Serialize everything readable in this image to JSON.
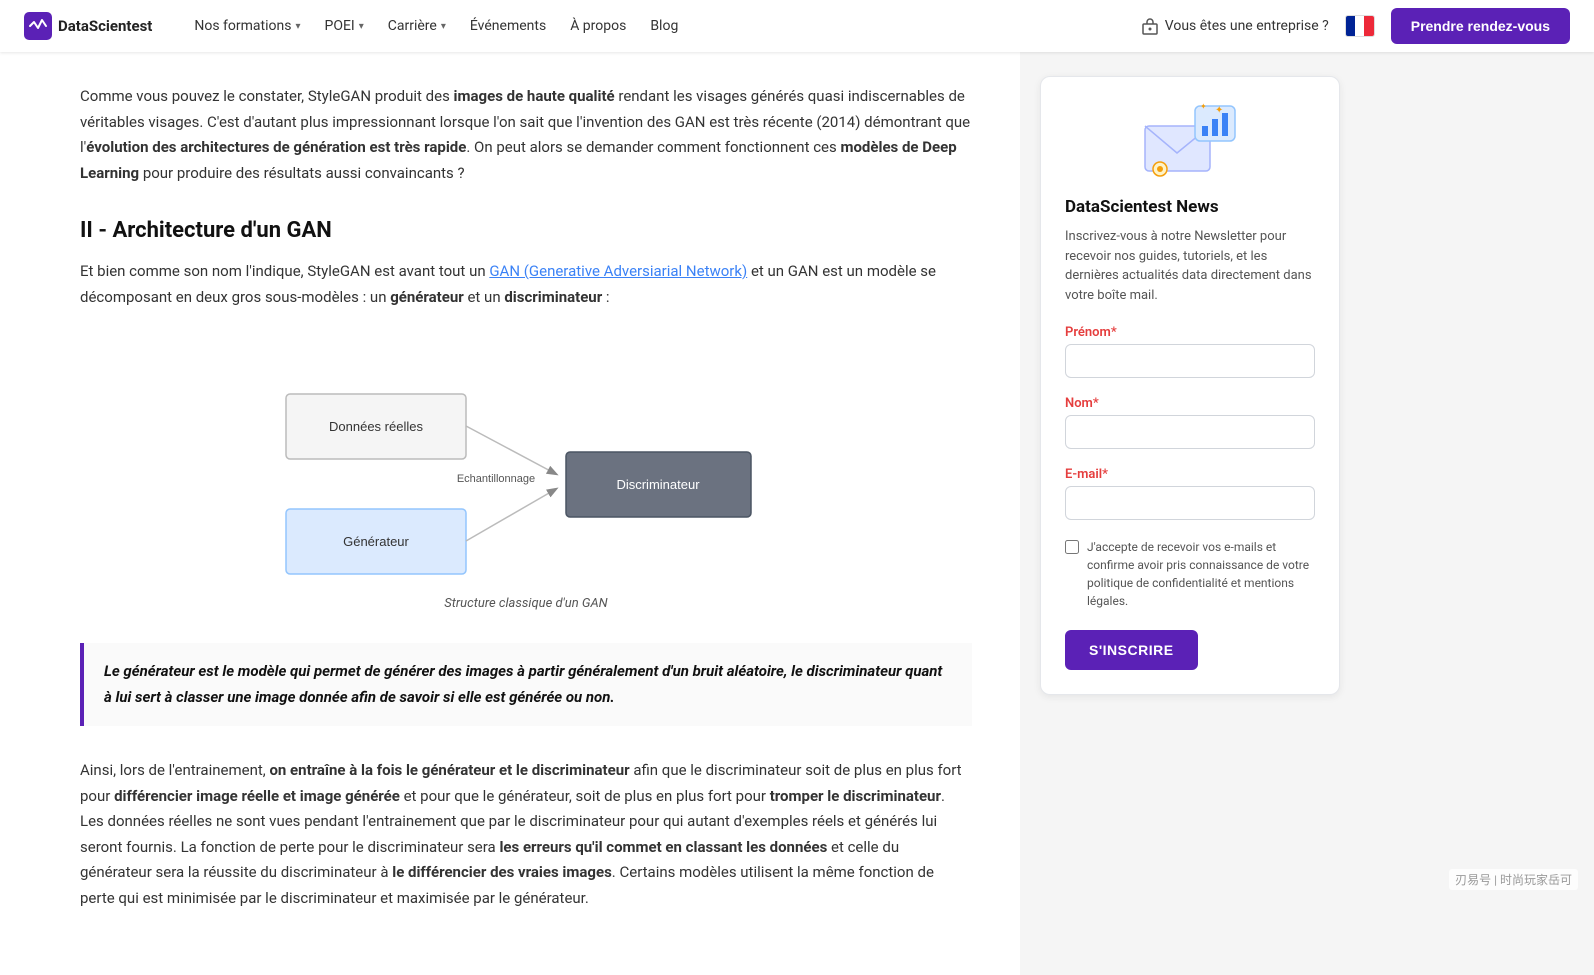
{
  "nav": {
    "logo_text": "DataScientest",
    "links": [
      {
        "label": "Nos formations",
        "has_dropdown": true
      },
      {
        "label": "POEI",
        "has_dropdown": true
      },
      {
        "label": "Carrière",
        "has_dropdown": true
      },
      {
        "label": "Événements",
        "has_dropdown": false
      },
      {
        "label": "À propos",
        "has_dropdown": false
      },
      {
        "label": "Blog",
        "has_dropdown": false
      }
    ],
    "enterprise_label": "Vous êtes une entreprise ?",
    "cta_label": "Prendre rendez-vous"
  },
  "main": {
    "intro_paragraph": "Comme vous pouvez le constater, StyleGAN produit des images de haute qualité rendant les visages générés quasi indiscernables de véritables visages. C'est d'autant plus impressionnant lorsque l'on sait que l'invention des GAN est très récente (2014) démontrant que l'évolution des architectures de génération est très rapide. On peut alors se demander comment fonctionnent ces modèles de Deep Learning pour produire des résultats aussi convaincants ?",
    "section_heading": "II - Architecture d'un GAN",
    "section_paragraph_1_pre": "Et bien comme son nom l'indique, StyleGAN est avant tout un ",
    "section_paragraph_1_link_text": "GAN (Generative Adversiarial Network)",
    "section_paragraph_1_post": " et un GAN est un modèle se décomposant en deux gros sous-modèles : un générateur et un discriminateur :",
    "diagram_caption": "Structure classique d'un GAN",
    "diagram_labels": {
      "donnees_reelles": "Données réelles",
      "generateur": "Générateur",
      "echantillonnage": "Echantillonnage",
      "discriminateur": "Discriminateur"
    },
    "highlight_text": "Le générateur est le modèle qui permet de générer des images à partir généralement d'un bruit aléatoire, le discriminateur quant à lui sert à classer une image donnée afin de savoir si elle est générée ou non.",
    "body_paragraph_1": "Ainsi, lors de l'entrainement, on entraîne à la fois le générateur et le discriminateur afin que le discriminateur soit de plus en plus fort pour différencier image réelle et image générée et pour que le générateur, soit de plus en plus fort pour tromper le discriminateur. Les données réelles ne sont vues pendant l'entrainement que par le discriminateur pour qui autant d'exemples réels et générés lui seront fournis. La fonction de perte pour le discriminateur sera les erreurs qu'il commet en classant les données et celle du générateur sera la réussite du discriminateur à le différencier des vraies images. Certains modèles utilisent la même fonction de perte qui est minimisée par le discriminateur et maximisée par le générateur."
  },
  "sidebar": {
    "title": "DataScientest News",
    "description": "Inscrivez-vous à notre Newsletter pour recevoir nos guides, tutoriels, et les dernières actualités data directement dans votre boîte mail.",
    "form": {
      "prenom_label": "Prénom",
      "prenom_required": true,
      "nom_label": "Nom",
      "nom_required": true,
      "email_label": "E-mail",
      "email_required": true,
      "checkbox_label": "J'accepte de recevoir vos e-mails et confirme avoir pris connaissance de votre politique de confidentialité et mentions légales.",
      "checkbox_required": true,
      "submit_label": "S'INSCRIRE"
    }
  },
  "watermark": "刃易号 | 时尚玩家岳可"
}
